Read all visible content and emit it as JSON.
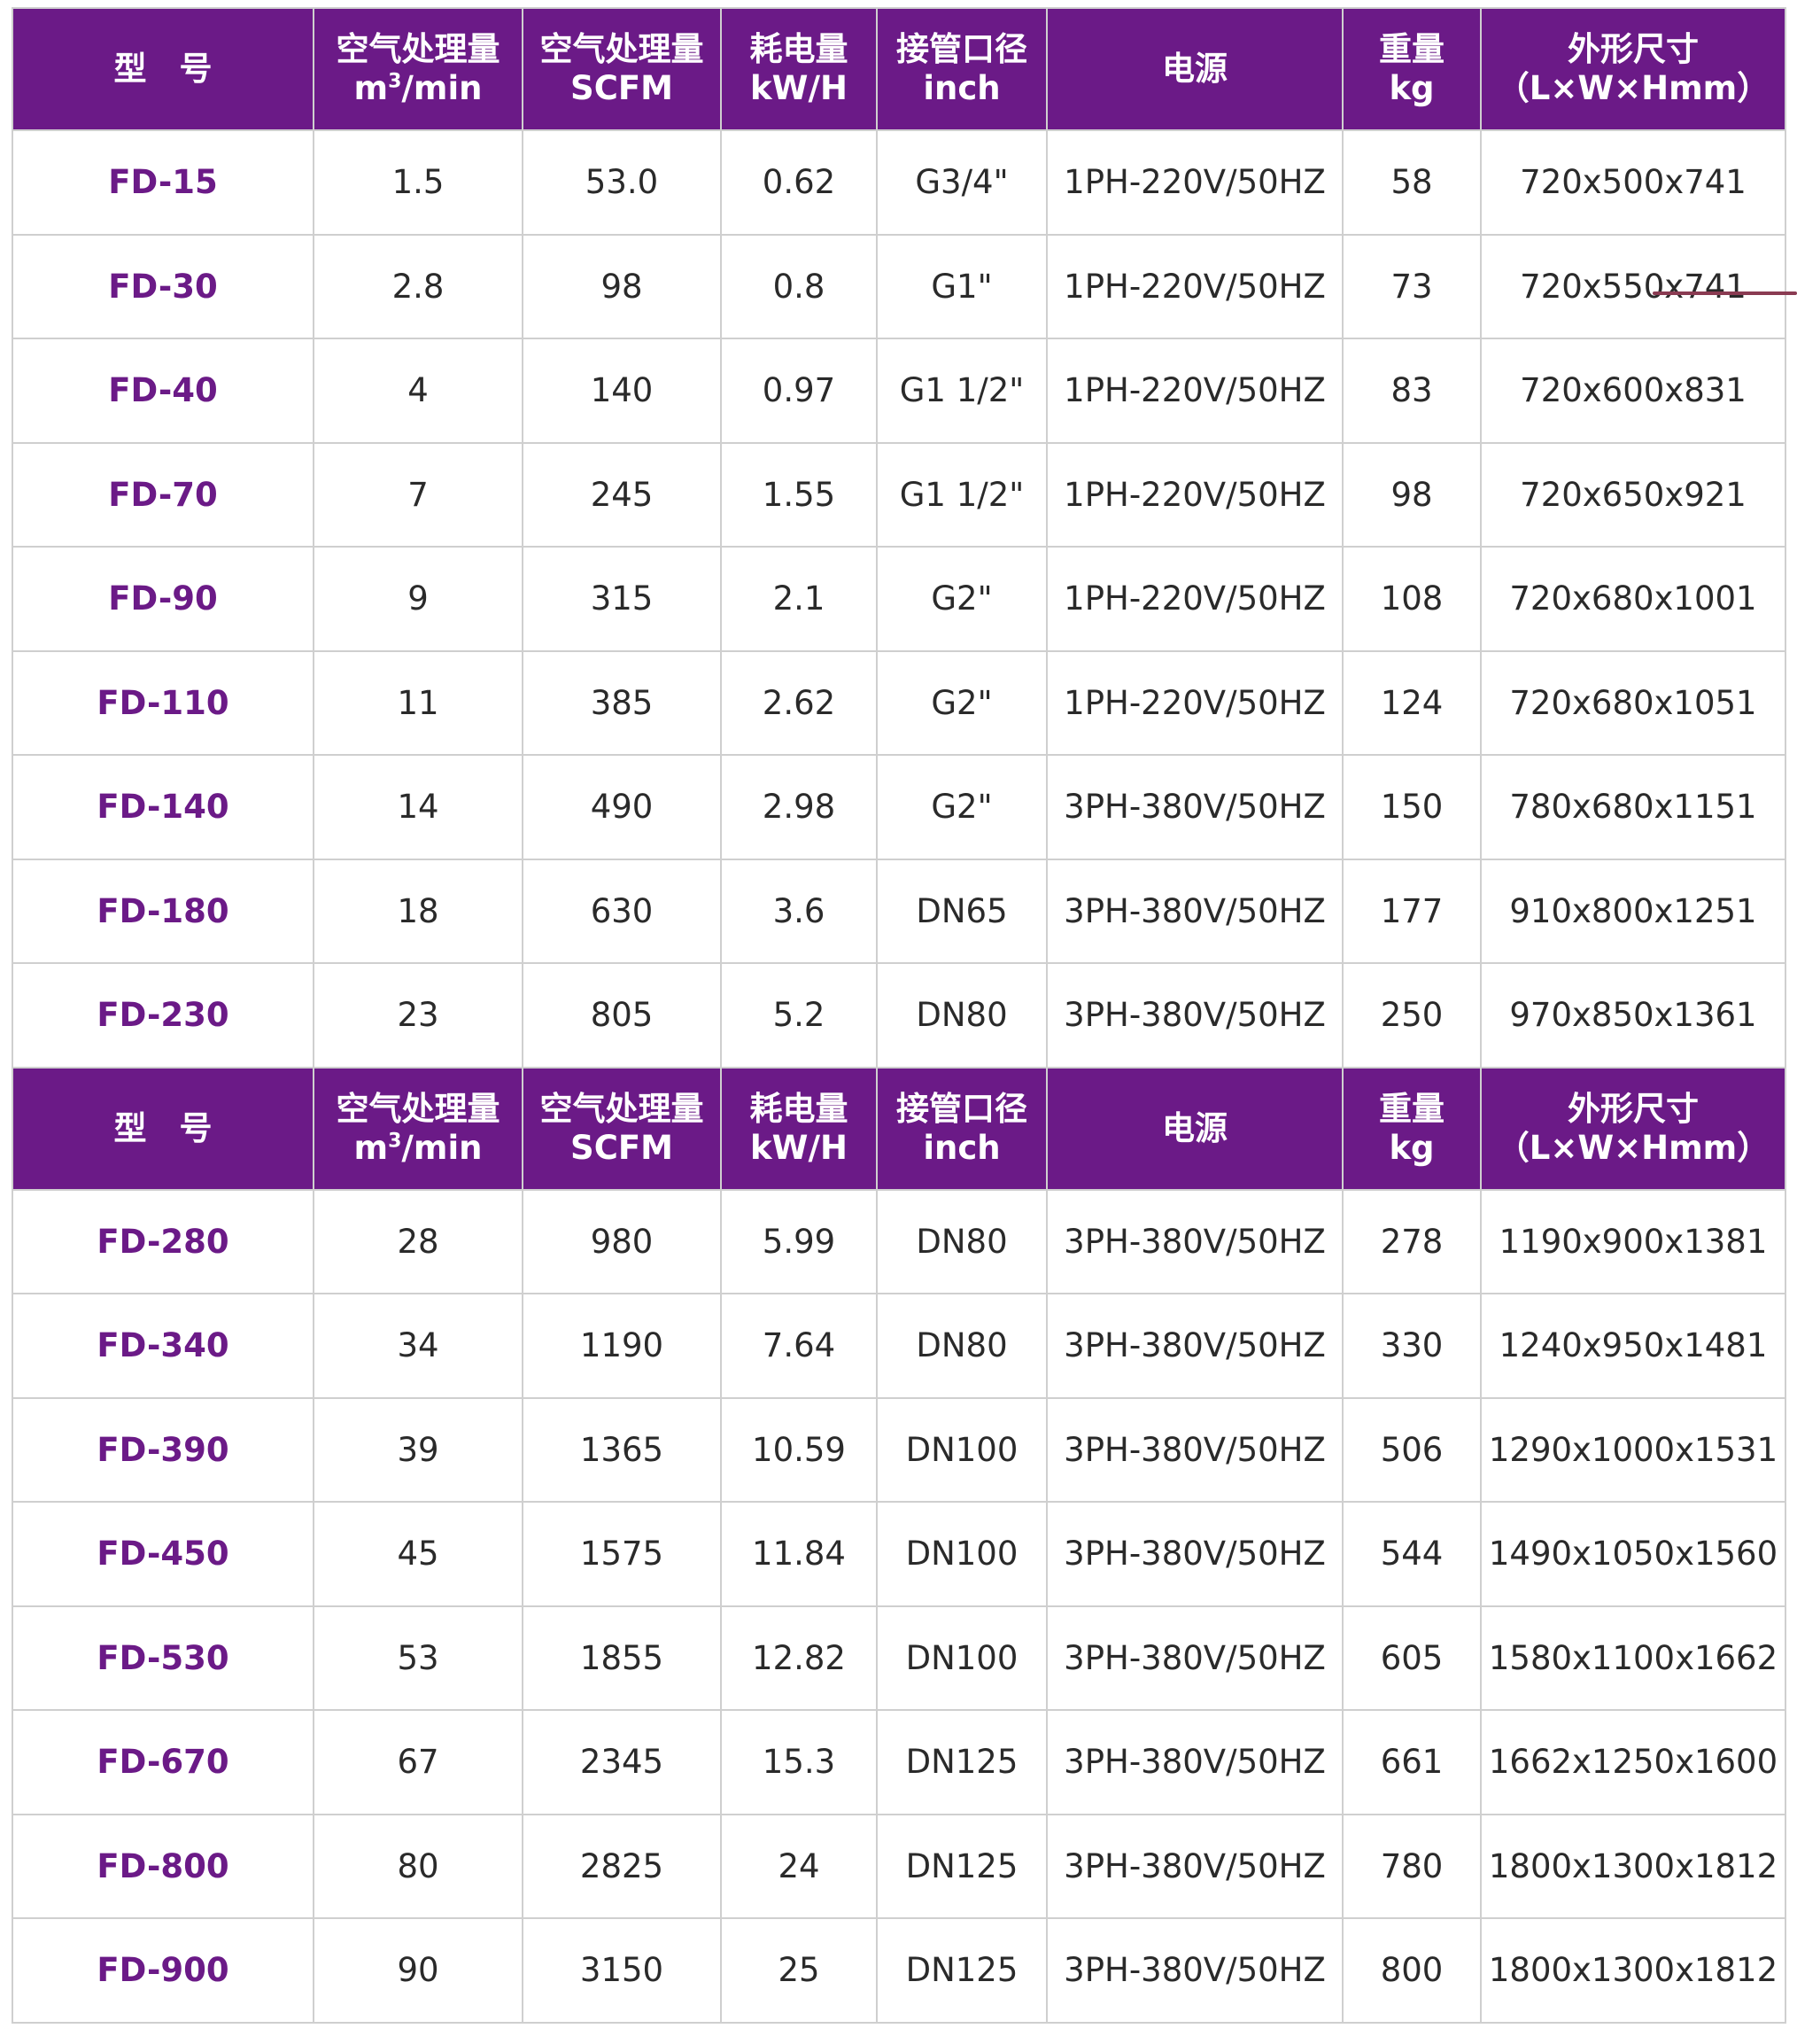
{
  "headers": [
    {
      "line1": "型　号",
      "line2": ""
    },
    {
      "line1": "空气处理量",
      "line2": "m³/min"
    },
    {
      "line1": "空气处理量",
      "line2": "SCFM"
    },
    {
      "line1": "耗电量",
      "line2": "kW/H"
    },
    {
      "line1": "接管口径",
      "line2": "inch"
    },
    {
      "line1": "电源",
      "line2": ""
    },
    {
      "line1": "重量",
      "line2": "kg"
    },
    {
      "line1": "外形尺寸",
      "line2": "（L×W×Hmm）"
    }
  ],
  "rows_a": [
    [
      "FD-15",
      "1.5",
      "53.0",
      "0.62",
      "G3/4\"",
      "1PH-220V/50HZ",
      "58",
      "720x500x741"
    ],
    [
      "FD-30",
      "2.8",
      "98",
      "0.8",
      "G1\"",
      "1PH-220V/50HZ",
      "73",
      "720x550x741"
    ],
    [
      "FD-40",
      "4",
      "140",
      "0.97",
      "G1 1/2\"",
      "1PH-220V/50HZ",
      "83",
      "720x600x831"
    ],
    [
      "FD-70",
      "7",
      "245",
      "1.55",
      "G1 1/2\"",
      "1PH-220V/50HZ",
      "98",
      "720x650x921"
    ],
    [
      "FD-90",
      "9",
      "315",
      "2.1",
      "G2\"",
      "1PH-220V/50HZ",
      "108",
      "720x680x1001"
    ],
    [
      "FD-110",
      "11",
      "385",
      "2.62",
      "G2\"",
      "1PH-220V/50HZ",
      "124",
      "720x680x1051"
    ],
    [
      "FD-140",
      "14",
      "490",
      "2.98",
      "G2\"",
      "3PH-380V/50HZ",
      "150",
      "780x680x1151"
    ],
    [
      "FD-180",
      "18",
      "630",
      "3.6",
      "DN65",
      "3PH-380V/50HZ",
      "177",
      "910x800x1251"
    ],
    [
      "FD-230",
      "23",
      "805",
      "5.2",
      "DN80",
      "3PH-380V/50HZ",
      "250",
      "970x850x1361"
    ]
  ],
  "rows_b": [
    [
      "FD-280",
      "28",
      "980",
      "5.99",
      "DN80",
      "3PH-380V/50HZ",
      "278",
      "1190x900x1381"
    ],
    [
      "FD-340",
      "34",
      "1190",
      "7.64",
      "DN80",
      "3PH-380V/50HZ",
      "330",
      "1240x950x1481"
    ],
    [
      "FD-390",
      "39",
      "1365",
      "10.59",
      "DN100",
      "3PH-380V/50HZ",
      "506",
      "1290x1000x1531"
    ],
    [
      "FD-450",
      "45",
      "1575",
      "11.84",
      "DN100",
      "3PH-380V/50HZ",
      "544",
      "1490x1050x1560"
    ],
    [
      "FD-530",
      "53",
      "1855",
      "12.82",
      "DN100",
      "3PH-380V/50HZ",
      "605",
      "1580x1100x1662"
    ],
    [
      "FD-670",
      "67",
      "2345",
      "15.3",
      "DN125",
      "3PH-380V/50HZ",
      "661",
      "1662x1250x1600"
    ],
    [
      "FD-800",
      "80",
      "2825",
      "24",
      "DN125",
      "3PH-380V/50HZ",
      "780",
      "1800x1300x1812"
    ],
    [
      "FD-900",
      "90",
      "3150",
      "25",
      "DN125",
      "3PH-380V/50HZ",
      "800",
      "1800x1300x1812"
    ]
  ],
  "colors": {
    "header_bg": "#6b1a87",
    "model_text": "#6b1a87",
    "grid": "#cfcfcf"
  }
}
